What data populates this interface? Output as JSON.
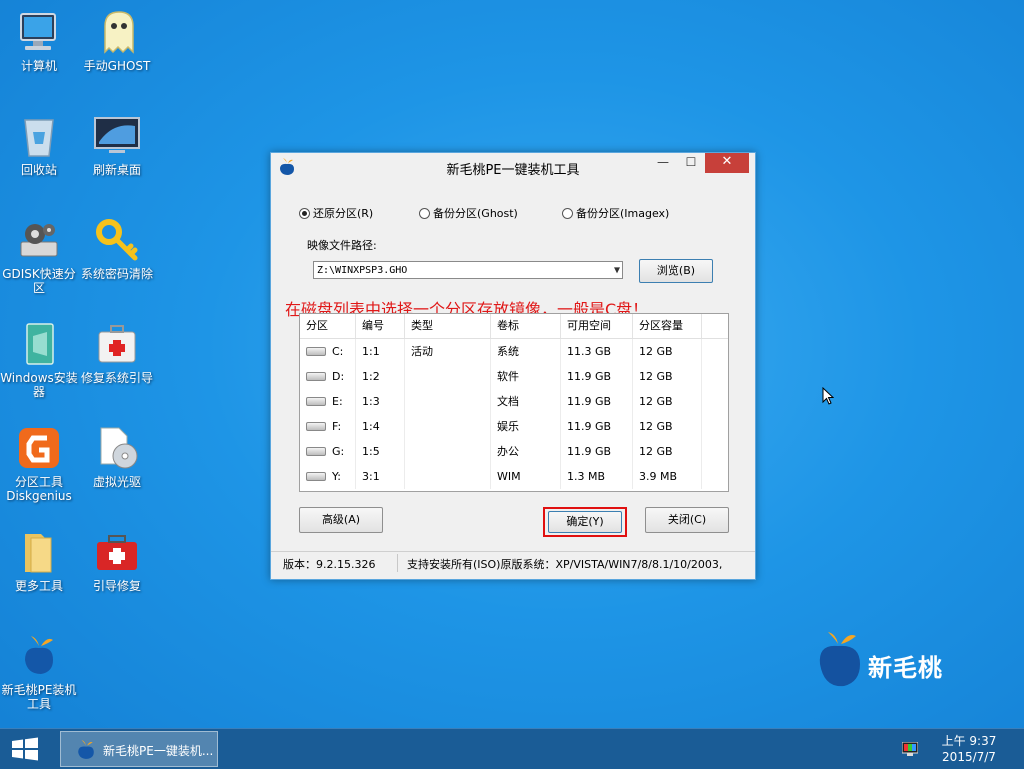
{
  "desktop": {
    "icons": [
      {
        "label": "计算机"
      },
      {
        "label": "手动GHOST"
      },
      {
        "label": "回收站"
      },
      {
        "label": "刷新桌面"
      },
      {
        "label": "GDISK快速分区"
      },
      {
        "label": "系统密码清除"
      },
      {
        "label": "Windows安装器"
      },
      {
        "label": "修复系统引导"
      },
      {
        "label": "分区工具Diskgenius"
      },
      {
        "label": "虚拟光驱"
      },
      {
        "label": "更多工具"
      },
      {
        "label": "引导修复"
      },
      {
        "label": "新毛桃PE装机工具"
      }
    ],
    "brand": "新毛桃"
  },
  "window": {
    "title": "新毛桃PE一键装机工具",
    "minimize": "—",
    "maximize": "☐",
    "close": "✕",
    "options": [
      {
        "label": "还原分区(R)",
        "selected": true
      },
      {
        "label": "备份分区(Ghost)",
        "selected": false
      },
      {
        "label": "备份分区(Imagex)",
        "selected": false
      }
    ],
    "image_path_label": "映像文件路径:",
    "image_path_value": "Z:\\WINXPSP3.GHO",
    "browse_label": "浏览(B)",
    "hint": "在磁盘列表中选择一个分区存放镜像，一般是C盘！",
    "table": {
      "columns": [
        "分区",
        "编号",
        "类型",
        "卷标",
        "可用空间",
        "分区容量"
      ],
      "rows": [
        [
          "C:",
          "1:1",
          "活动",
          "系统",
          "11.3 GB",
          "12 GB"
        ],
        [
          "D:",
          "1:2",
          "",
          "软件",
          "11.9 GB",
          "12 GB"
        ],
        [
          "E:",
          "1:3",
          "",
          "文档",
          "11.9 GB",
          "12 GB"
        ],
        [
          "F:",
          "1:4",
          "",
          "娱乐",
          "11.9 GB",
          "12 GB"
        ],
        [
          "G:",
          "1:5",
          "",
          "办公",
          "11.9 GB",
          "12 GB"
        ],
        [
          "Y:",
          "3:1",
          "",
          "WIM",
          "1.3 MB",
          "3.9 MB"
        ]
      ]
    },
    "advanced_label": "高级(A)",
    "ok_label": "确定(Y)",
    "close_label": "关闭(C)",
    "status_version": "版本：9.2.15.326",
    "status_support": "支持安装所有(ISO)原版系统：XP/VISTA/WIN7/8/8.1/10/2003,"
  },
  "taskbar": {
    "task_label": "新毛桃PE一键装机...",
    "time": "上午 9:37",
    "date": "2015/7/7"
  },
  "colors": {
    "desktop_bg": "#1e95e6",
    "taskbar_bg": "#1a5c96",
    "close_red": "#c7403a",
    "hint_red": "#e01818",
    "highlight_red": "#e01010"
  }
}
